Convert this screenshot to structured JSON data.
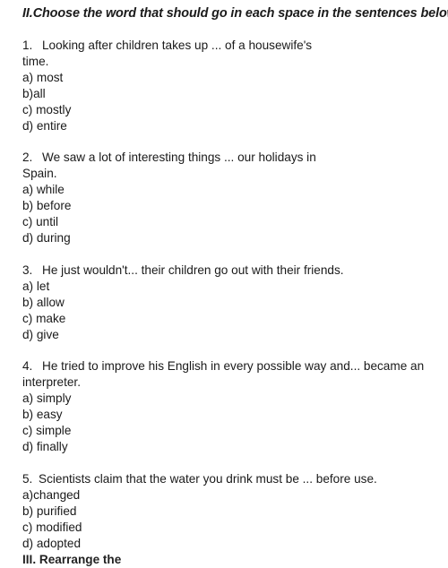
{
  "title": "II.Choose the word that should go in each space in the sentences below",
  "questions": [
    {
      "number": "1.",
      "text": "Looking after children takes up ... of a housewife's time.",
      "options": [
        "a) most",
        "b)all",
        "c) mostly",
        "d) entire"
      ]
    },
    {
      "number": "2.",
      "text": "We saw a lot of interesting things ... our holidays in Spain.",
      "options": [
        "a) while",
        "b) before",
        "c) until",
        "d) during"
      ]
    },
    {
      "number": "3.",
      "text": "He just wouldn't... their children go out with their friends.",
      "options": [
        "a) let",
        "b) allow",
        "c) make",
        "d) give"
      ]
    },
    {
      "number": "4.",
      "text": "He tried to improve his English in every possible way and... became an interpreter.",
      "options": [
        "a) simply",
        "b) easy",
        "c) simple",
        "d) finally"
      ]
    },
    {
      "number": "5.",
      "text": "Scientists claim that the water you drink must be ... before use.",
      "options": [
        "a)changed",
        "b) purified",
        "c) modified",
        "d) adopted"
      ]
    }
  ],
  "next_section_heading": "III. Rearrange the"
}
